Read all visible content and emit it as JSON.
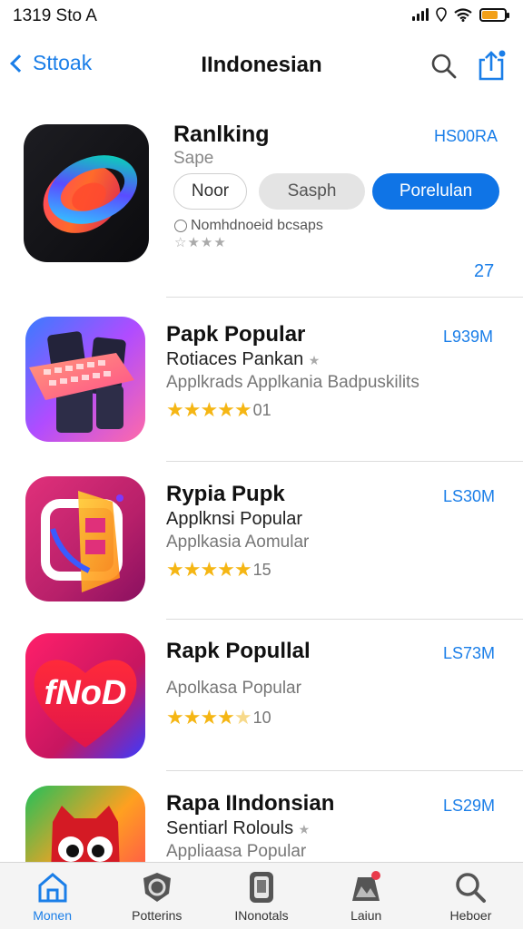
{
  "status_bar": {
    "time": "1319 Sto A",
    "battery_level": 0.7,
    "battery_color": "#f2a019"
  },
  "nav": {
    "back_label": "Sttoak",
    "title": "IIndonesian",
    "icons": [
      "search-icon",
      "share-icon"
    ]
  },
  "featured": {
    "title": "Ranlking",
    "subtitle": "Sape",
    "size": "HS00RA",
    "pills": [
      "Noor",
      "Sasph",
      "Porelulan"
    ],
    "note": "Nomhdnoeid bcsaps",
    "stars": "☆★★★",
    "count": "27"
  },
  "apps": [
    {
      "title": "Papk Popular",
      "subtitle": "Rotiaces Pankan",
      "description": "Applkrads Applkania Badpuskilits",
      "rating_count": "01",
      "stars": 5,
      "size": "L939M"
    },
    {
      "title": "Rypia Pupk",
      "subtitle": "Applknsi Popular",
      "description": "Applkasia Aomular",
      "rating_count": "15",
      "stars": 5,
      "size": "LS30M"
    },
    {
      "title": "Rapk Popullal",
      "subtitle": "",
      "description": "Apolkasa Popular",
      "rating_count": "10",
      "stars": 4.5,
      "size": "LS73M"
    },
    {
      "title": "Rapa IIndonsian",
      "subtitle": "Sentiarl Rolouls",
      "description": "Appliaasa Popular",
      "rating_count": "",
      "stars": 0,
      "size": "LS29M"
    }
  ],
  "tabs": [
    {
      "label": "Monen",
      "icon": "home-icon",
      "active": true
    },
    {
      "label": "Potterins",
      "icon": "shield-icon",
      "active": false
    },
    {
      "label": "INonotals",
      "icon": "card-icon",
      "active": false
    },
    {
      "label": "Laiun",
      "icon": "game-icon",
      "active": false
    },
    {
      "label": "Heboer",
      "icon": "search-icon",
      "active": false
    }
  ],
  "colors": {
    "accent": "#1a7ee8",
    "primary_button": "#0f74e6",
    "star": "#f5b614"
  }
}
